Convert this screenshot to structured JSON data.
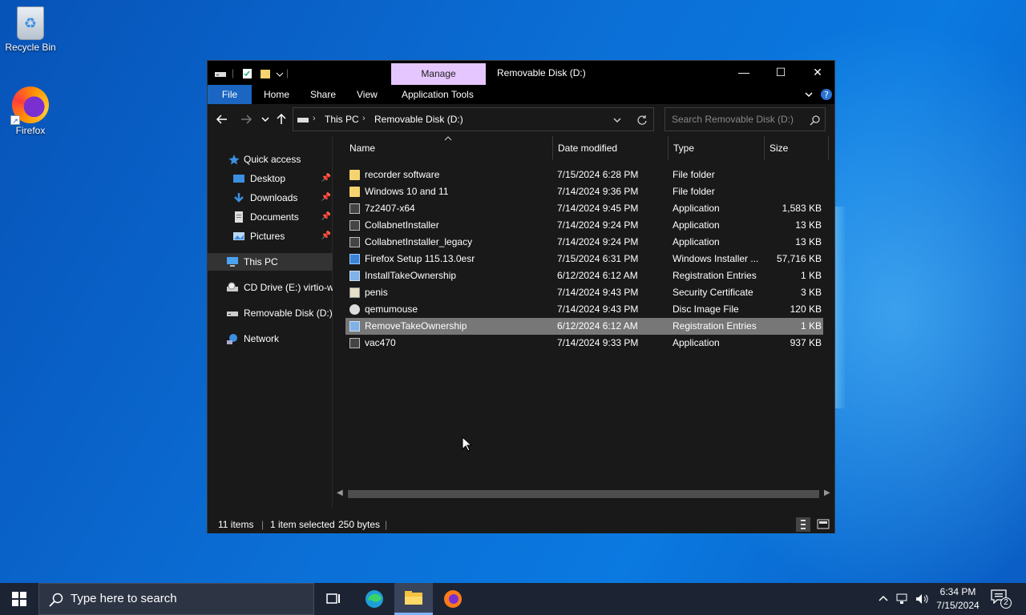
{
  "desktop": {
    "icons": [
      {
        "label": "Recycle Bin",
        "icon": "recycle-bin-icon"
      },
      {
        "label": "Firefox",
        "icon": "firefox-icon"
      }
    ]
  },
  "window": {
    "title": "Removable Disk (D:)",
    "context_tab": "Manage",
    "ribbon_tabs": [
      "File",
      "Home",
      "Share",
      "View",
      "Application Tools"
    ],
    "controls": {
      "minimize": "—",
      "maximize": "☐",
      "close": "✕"
    }
  },
  "address": {
    "breadcrumbs": [
      "This PC",
      "Removable Disk (D:)"
    ],
    "search_placeholder": "Search Removable Disk (D:)"
  },
  "nav": {
    "items": [
      {
        "label": "Quick access",
        "icon": "star-icon"
      },
      {
        "label": "Desktop",
        "icon": "desktop-icon",
        "pinned": true
      },
      {
        "label": "Downloads",
        "icon": "download-icon",
        "pinned": true
      },
      {
        "label": "Documents",
        "icon": "documents-icon",
        "pinned": true
      },
      {
        "label": "Pictures",
        "icon": "pictures-icon",
        "pinned": true
      },
      {
        "label": "This PC",
        "icon": "computer-icon",
        "selected": true
      },
      {
        "label": "CD Drive (E:) virtio-w",
        "icon": "cd-drive-icon"
      },
      {
        "label": "Removable Disk (D:)",
        "icon": "usb-drive-icon"
      },
      {
        "label": "Network",
        "icon": "network-icon"
      }
    ]
  },
  "files": {
    "columns": [
      "Name",
      "Date modified",
      "Type",
      "Size"
    ],
    "rows": [
      {
        "name": "recorder software",
        "date": "7/15/2024 6:28 PM",
        "type": "File folder",
        "size": "",
        "icon": "folder"
      },
      {
        "name": "Windows 10 and 11",
        "date": "7/14/2024 9:36 PM",
        "type": "File folder",
        "size": "",
        "icon": "folder"
      },
      {
        "name": "7z2407-x64",
        "date": "7/14/2024 9:45 PM",
        "type": "Application",
        "size": "1,583 KB",
        "icon": "app"
      },
      {
        "name": "CollabnetInstaller",
        "date": "7/14/2024 9:24 PM",
        "type": "Application",
        "size": "13 KB",
        "icon": "app"
      },
      {
        "name": "CollabnetInstaller_legacy",
        "date": "7/14/2024 9:24 PM",
        "type": "Application",
        "size": "13 KB",
        "icon": "app"
      },
      {
        "name": "Firefox Setup 115.13.0esr",
        "date": "7/15/2024 6:31 PM",
        "type": "Windows Installer ...",
        "size": "57,716 KB",
        "icon": "msi"
      },
      {
        "name": "InstallTakeOwnership",
        "date": "6/12/2024 6:12 AM",
        "type": "Registration Entries",
        "size": "1 KB",
        "icon": "reg"
      },
      {
        "name": "penis",
        "date": "7/14/2024 9:43 PM",
        "type": "Security Certificate",
        "size": "3 KB",
        "icon": "cert"
      },
      {
        "name": "qemumouse",
        "date": "7/14/2024 9:43 PM",
        "type": "Disc Image File",
        "size": "120 KB",
        "icon": "disc"
      },
      {
        "name": "RemoveTakeOwnership",
        "date": "6/12/2024 6:12 AM",
        "type": "Registration Entries",
        "size": "1 KB",
        "icon": "reg",
        "selected": true
      },
      {
        "name": "vac470",
        "date": "7/14/2024 9:33 PM",
        "type": "Application",
        "size": "937 KB",
        "icon": "app"
      }
    ]
  },
  "status": {
    "item_count": "11 items",
    "selection": "1 item selected",
    "size": "250 bytes"
  },
  "taskbar": {
    "search_placeholder": "Type here to search",
    "time": "6:34 PM",
    "date": "7/15/2024",
    "notifications": "2"
  }
}
